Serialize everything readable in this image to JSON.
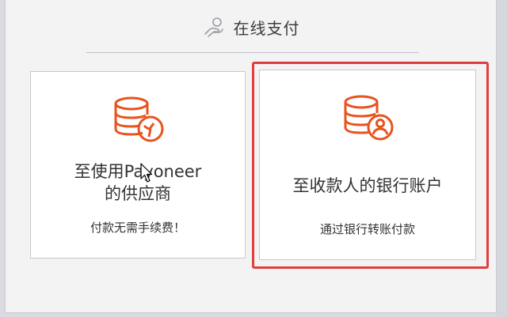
{
  "header": {
    "title": "在线支付",
    "icon": "hand-coin-icon"
  },
  "options": [
    {
      "id": "payoneer",
      "title_line1": "至使用Payoneer",
      "title_line2": "的供应商",
      "subtitle": "付款无需手续费！",
      "icon": "database-payoneer-icon",
      "selected": false
    },
    {
      "id": "bank",
      "title_line1": "至收款人的银行账户",
      "subtitle": "通过银行转账付款",
      "icon": "database-user-icon",
      "selected": true
    }
  ],
  "colors": {
    "accent": "#e8531e",
    "selection": "#e03e3e",
    "text": "#333333"
  }
}
